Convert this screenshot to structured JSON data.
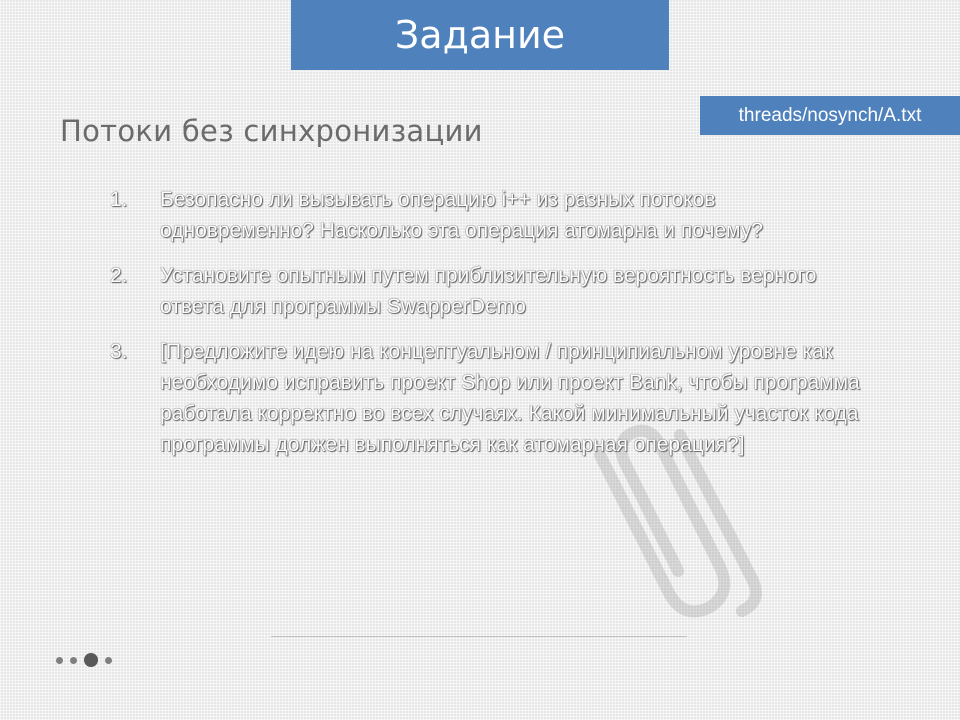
{
  "slide": {
    "title": "Задание",
    "file_tag": "threads/nosynch/A.txt",
    "subtitle": "Потоки без синхронизации",
    "tasks": [
      {
        "number": "1.",
        "text": "Безопасно ли вызывать операцию i++ из разных потоков одновременно? Насколько эта операция атомарна и почему?"
      },
      {
        "number": "2.",
        "text": "Установите опытным путем приблизительную вероятность верного ответа для программы SwapperDemo"
      },
      {
        "number": "3.",
        "text": "[Предложите идею на концептуальном / принципиальном уровне как необходимо исправить проект Shop или проект Bank, чтобы программа работала корректно во всех случаях. Какой минимальный участок кода программы должен выполняться как атомарная операция?]"
      }
    ]
  },
  "decor": {
    "background_icon": "paperclip-icon",
    "accent_color": "#4f81bd"
  }
}
